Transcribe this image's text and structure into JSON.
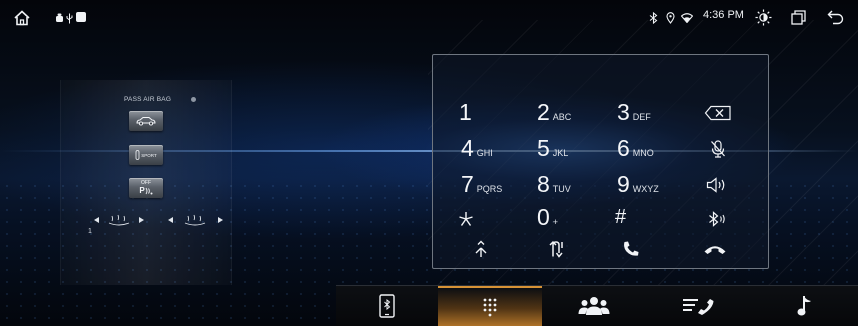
{
  "statusbar": {
    "time": "4:36 PM",
    "icons": [
      "home-icon",
      "android-icon",
      "usb-icon",
      "notification-icon",
      "bluetooth-icon",
      "location-icon",
      "wifi-icon",
      "brightness-icon",
      "recent-apps-icon",
      "back-icon"
    ]
  },
  "climate": {
    "pass_airbag_label": "PASS AIR BAG",
    "sport_label": "SPORT",
    "off_label": "OFF",
    "p_label": "P",
    "seat_number": "1"
  },
  "dialpad": {
    "keys": [
      {
        "digit": "1",
        "letters": ""
      },
      {
        "digit": "2",
        "letters": "ABC"
      },
      {
        "digit": "3",
        "letters": "DEF"
      },
      {
        "digit": "4",
        "letters": "GHI"
      },
      {
        "digit": "5",
        "letters": "JKL"
      },
      {
        "digit": "6",
        "letters": "MNO"
      },
      {
        "digit": "7",
        "letters": "PQRS"
      },
      {
        "digit": "8",
        "letters": "TUV"
      },
      {
        "digit": "9",
        "letters": "WXYZ"
      },
      {
        "digit": "*",
        "letters": ""
      },
      {
        "digit": "0",
        "letters": "+"
      },
      {
        "digit": "#",
        "letters": ""
      }
    ],
    "side_icons": [
      "backspace-icon",
      "mic-mute-icon",
      "speaker-icon",
      "bluetooth-audio-icon"
    ],
    "bottom_icons": [
      "merge-call-icon",
      "swap-call-icon",
      "call-icon",
      "hangup-icon"
    ]
  },
  "bottom_nav": {
    "tabs": [
      "phone-link-icon",
      "dialpad-icon",
      "contacts-icon",
      "call-log-icon",
      "music-icon"
    ],
    "active_tab": "dialpad-icon"
  },
  "colors": {
    "accent": "#d79236",
    "panel_border": "#6f7680",
    "background": "#05070c"
  }
}
